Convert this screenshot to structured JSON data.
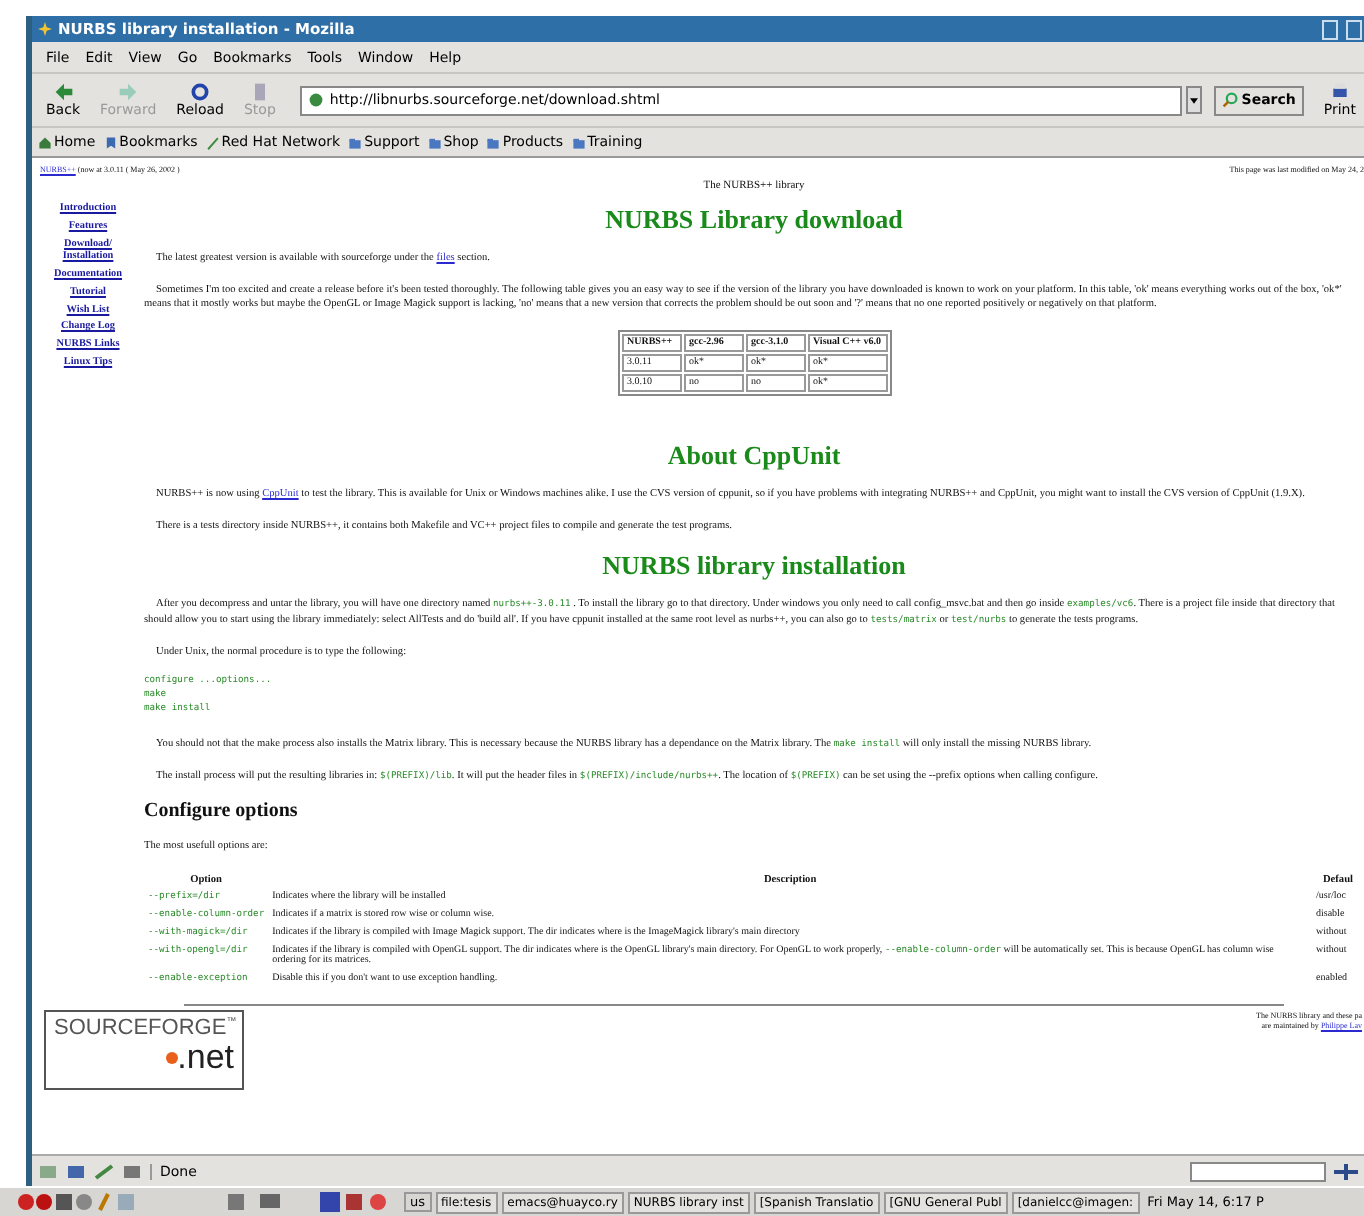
{
  "window": {
    "title": "NURBS library installation - Mozilla"
  },
  "menu": [
    "File",
    "Edit",
    "View",
    "Go",
    "Bookmarks",
    "Tools",
    "Window",
    "Help"
  ],
  "toolbar": {
    "buttons": [
      {
        "kind": "back",
        "label": "Back",
        "disabled": false
      },
      {
        "kind": "forward",
        "label": "Forward",
        "disabled": true
      },
      {
        "kind": "reload",
        "label": "Reload",
        "disabled": false
      },
      {
        "kind": "stop",
        "label": "Stop",
        "disabled": true
      }
    ],
    "url": "http://libnurbs.sourceforge.net/download.shtml",
    "search": "Search",
    "print": "Print"
  },
  "bookmarks": [
    {
      "kind": "home",
      "label": "Home"
    },
    {
      "kind": "bookmarks",
      "label": "Bookmarks"
    },
    {
      "kind": "redhat",
      "label": "Red Hat Network"
    },
    {
      "kind": "folder",
      "label": "Support"
    },
    {
      "kind": "folder",
      "label": "Shop"
    },
    {
      "kind": "folder",
      "label": "Products"
    },
    {
      "kind": "folder",
      "label": "Training"
    }
  ],
  "page": {
    "top_left": [
      {
        "kind": "link",
        "text": "NURBS++"
      },
      {
        "kind": "text",
        "text": " (now at 3.0.11 ( May 26, 2002 )"
      }
    ],
    "top_right": "This page was last modified on May 24, 2",
    "sidebar": [
      "Introduction",
      "Features",
      "Download/ Installation",
      "Documentation",
      "Tutorial",
      "Wish List",
      "Change Log",
      "NURBS Links",
      "Linux Tips"
    ],
    "blocks": [
      {
        "kind": "caption",
        "text": "The NURBS++ library"
      },
      {
        "kind": "heading",
        "text": "NURBS Library download"
      },
      {
        "kind": "para",
        "segs": [
          {
            "kind": "text",
            "text": "The latest greatest version is available with sourceforge under the "
          },
          {
            "kind": "link",
            "text": "files"
          },
          {
            "kind": "text",
            "text": " section."
          }
        ]
      },
      {
        "kind": "para",
        "segs": [
          {
            "kind": "text",
            "text": "Sometimes I'm too excited and create a release before it's been tested thoroughly. The following table gives you an easy way to see if the version of the library you have downloaded is known to work on your platform. In this table, 'ok' means everything works out of the box, 'ok*' means that it mostly works but maybe the OpenGL or Image Magick support is lacking, 'no' means that a new version that corrects the problem should be out soon and '?' means that no one reported positively or negatively on that platform."
          }
        ]
      },
      {
        "kind": "table",
        "columns": [
          "NURBS++",
          "gcc-2.96",
          "gcc-3.1.0",
          "Visual C++ v6.0"
        ],
        "rows": [
          [
            "3.0.11",
            "ok*",
            "ok*",
            "ok*"
          ],
          [
            "3.0.10",
            "no",
            "no",
            "ok*"
          ]
        ]
      },
      {
        "kind": "heading",
        "text": "About CppUnit"
      },
      {
        "kind": "para",
        "segs": [
          {
            "kind": "text",
            "text": "NURBS++ is now using "
          },
          {
            "kind": "link",
            "text": "CppUnit"
          },
          {
            "kind": "text",
            "text": " to test the library. This is available for Unix or Windows machines alike. I use the CVS version of cppunit, so if you have problems with integrating NURBS++ and CppUnit, you might want to install the CVS version of CppUnit (1.9.X)."
          }
        ]
      },
      {
        "kind": "para",
        "segs": [
          {
            "kind": "text",
            "text": "There is a tests directory inside NURBS++, it contains both Makefile and VC++ project files to compile and generate the test programs."
          }
        ]
      },
      {
        "kind": "heading",
        "text": "NURBS library installation"
      },
      {
        "kind": "para",
        "segs": [
          {
            "kind": "text",
            "text": "After you decompress and untar the library, you will have one directory named "
          },
          {
            "kind": "code",
            "text": "nurbs++-3.0.11"
          },
          {
            "kind": "text",
            "text": " . To install the library go to that directory. Under windows you only need to call config_msvc.bat and then go inside "
          },
          {
            "kind": "code",
            "text": "examples/vc6"
          },
          {
            "kind": "text",
            "text": ". There is a project file inside that directory that should allow you to start using the library immediately: select AllTests and do 'build all'. If you have cppunit installed at the same root level as nurbs++, you can also go to "
          },
          {
            "kind": "code",
            "text": "tests/matrix"
          },
          {
            "kind": "text",
            "text": " or "
          },
          {
            "kind": "code",
            "text": "test/nurbs"
          },
          {
            "kind": "text",
            "text": " to generate the tests programs."
          }
        ]
      },
      {
        "kind": "para",
        "segs": [
          {
            "kind": "text",
            "text": "Under Unix, the normal procedure is to type the following:"
          }
        ]
      },
      {
        "kind": "pre",
        "lines": [
          "configure ...options...",
          "make",
          "make install"
        ]
      },
      {
        "kind": "para",
        "segs": [
          {
            "kind": "text",
            "text": "You should not that the make process also installs the Matrix library. This is necessary because the NURBS library has a dependance on the Matrix library. The "
          },
          {
            "kind": "code",
            "text": "make install"
          },
          {
            "kind": "text",
            "text": " will only install the missing NURBS library."
          }
        ]
      },
      {
        "kind": "para",
        "segs": [
          {
            "kind": "text",
            "text": "The install process will put the resulting libraries in: "
          },
          {
            "kind": "code",
            "text": "$(PREFIX)/lib"
          },
          {
            "kind": "text",
            "text": ". It will put the header files in "
          },
          {
            "kind": "code",
            "text": "$(PREFIX)/include/nurbs++"
          },
          {
            "kind": "text",
            "text": ". The location of "
          },
          {
            "kind": "code",
            "text": "$(PREFIX)"
          },
          {
            "kind": "text",
            "text": " can be set using the --prefix options when calling configure."
          }
        ]
      },
      {
        "kind": "subheading",
        "text": "Configure options"
      },
      {
        "kind": "plain",
        "segs": [
          {
            "kind": "text",
            "text": "The most usefull options are:"
          }
        ]
      },
      {
        "kind": "options",
        "columns": [
          "Option",
          "Description",
          "Defaul"
        ],
        "rows": [
          {
            "option": "--prefix=/dir",
            "desc": [
              {
                "kind": "text",
                "text": "Indicates where the library will be installed"
              }
            ],
            "default": "/usr/loc"
          },
          {
            "option": "--enable-column-order",
            "desc": [
              {
                "kind": "text",
                "text": "Indicates if a matrix is stored row wise or column wise."
              }
            ],
            "default": "disable"
          },
          {
            "option": "--with-magick=/dir",
            "desc": [
              {
                "kind": "text",
                "text": "Indicates if the library is compiled with Image Magick support. The dir indicates where is the ImageMagick library's main directory"
              }
            ],
            "default": "without"
          },
          {
            "option": "--with-opengl=/dir",
            "desc": [
              {
                "kind": "text",
                "text": "Indicates if the library is compiled with OpenGL support. The dir indicates where is the OpenGL library's main directory. For OpenGL to work properly, "
              },
              {
                "kind": "code",
                "text": "--enable-column-order"
              },
              {
                "kind": "text",
                "text": " will be automatically set. This is because OpenGL has column wise ordering for its matrices."
              }
            ],
            "default": "without"
          },
          {
            "option": "--enable-exception",
            "desc": [
              {
                "kind": "text",
                "text": "Disable this if you don't want to use exception handling."
              }
            ],
            "default": "enabled"
          }
        ]
      }
    ],
    "logo": {
      "word": "SOURCEFORGE",
      "tm": "™",
      "net": ".net"
    },
    "credit": [
      {
        "segs": [
          {
            "kind": "text",
            "text": "The NURBS library and these pa"
          }
        ]
      },
      {
        "segs": [
          {
            "kind": "text",
            "text": "are maintained by "
          },
          {
            "kind": "link",
            "text": "Philippe Lav"
          }
        ]
      }
    ]
  },
  "status_bar": {
    "text": "Done"
  },
  "taskbar": {
    "lang": "us",
    "tasks": [
      "file:tesis",
      "emacs@huayco.ry",
      "NURBS library inst",
      "[Spanish Translatio",
      "[GNU General Publ",
      "[danielcc@imagen:"
    ],
    "clock": "Fri May 14,  6:17 P"
  }
}
